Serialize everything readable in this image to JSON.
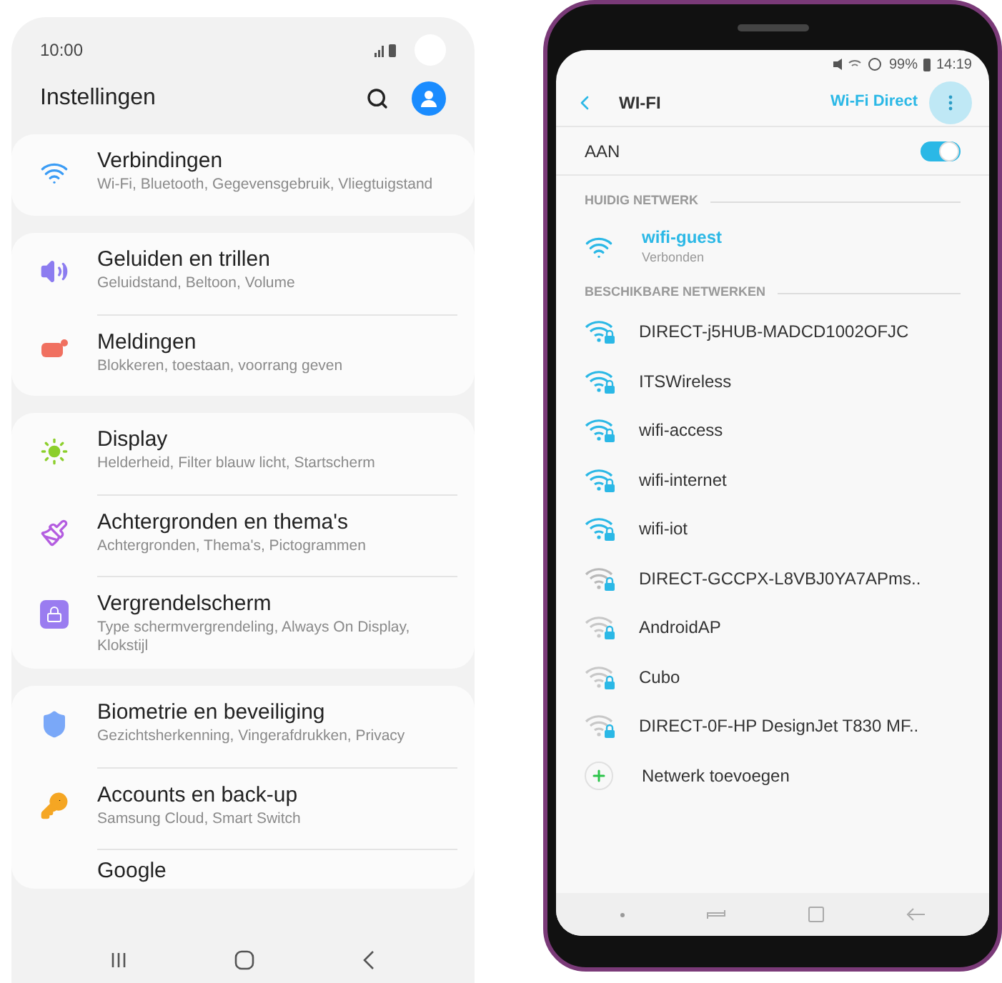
{
  "settings_phone": {
    "status_bar": {
      "time": "10:00"
    },
    "title": "Instellingen",
    "groups": [
      [
        {
          "kind": "wifi",
          "title": "Verbindingen",
          "subtitle": "Wi-Fi, Bluetooth, Gegevensgebruik, Vliegtuigstand"
        }
      ],
      [
        {
          "kind": "sound",
          "title": "Geluiden en trillen",
          "subtitle": "Geluidstand, Beltoon, Volume"
        },
        {
          "kind": "notification",
          "title": "Meldingen",
          "subtitle": "Blokkeren, toestaan, voorrang geven"
        }
      ],
      [
        {
          "kind": "display",
          "title": "Display",
          "subtitle": "Helderheid, Filter blauw licht, Startscherm"
        },
        {
          "kind": "brush",
          "title": "Achtergronden en thema's",
          "subtitle": "Achtergronden, Thema's, Pictogrammen"
        },
        {
          "kind": "lock",
          "title": "Vergrendelscherm",
          "subtitle": "Type schermvergrendeling, Always On Display, Klokstijl"
        }
      ],
      [
        {
          "kind": "shield",
          "title": "Biometrie en beveiliging",
          "subtitle": "Gezichtsherkenning, Vingerafdrukken, Privacy"
        },
        {
          "kind": "key",
          "title": "Accounts en back-up",
          "subtitle": "Samsung Cloud, Smart Switch"
        },
        {
          "title": "Google"
        }
      ]
    ]
  },
  "wifi_phone": {
    "status_bar": {
      "battery": "99%",
      "time": "14:19"
    },
    "title": "WI-FI",
    "wifi_direct": "Wi-Fi Direct",
    "toggle": {
      "label": "AAN",
      "on": true
    },
    "current_section": "HUIDIG NETWERK",
    "current": {
      "name": "wifi-guest",
      "status": "Verbonden"
    },
    "available_section": "BESCHIKBARE NETWERKEN",
    "networks": [
      {
        "name": "DIRECT-j5HUB-MADCD1002OFJC",
        "color": "#2bb8e6"
      },
      {
        "name": "ITSWireless",
        "color": "#2bb8e6"
      },
      {
        "name": "wifi-access",
        "color": "#2bb8e6"
      },
      {
        "name": "wifi-internet",
        "color": "#2bb8e6"
      },
      {
        "name": "wifi-iot",
        "color": "#2bb8e6"
      },
      {
        "name": "DIRECT-GCCPX-L8VBJ0YA7APms..",
        "color": "#b9b9b9"
      },
      {
        "name": "AndroidAP",
        "color": "#c8c8c8"
      },
      {
        "name": "Cubo",
        "color": "#c8c8c8"
      },
      {
        "name": "DIRECT-0F-HP DesignJet T830 MF..",
        "color": "#c8c8c8"
      }
    ],
    "add_network": "Netwerk toevoegen"
  }
}
